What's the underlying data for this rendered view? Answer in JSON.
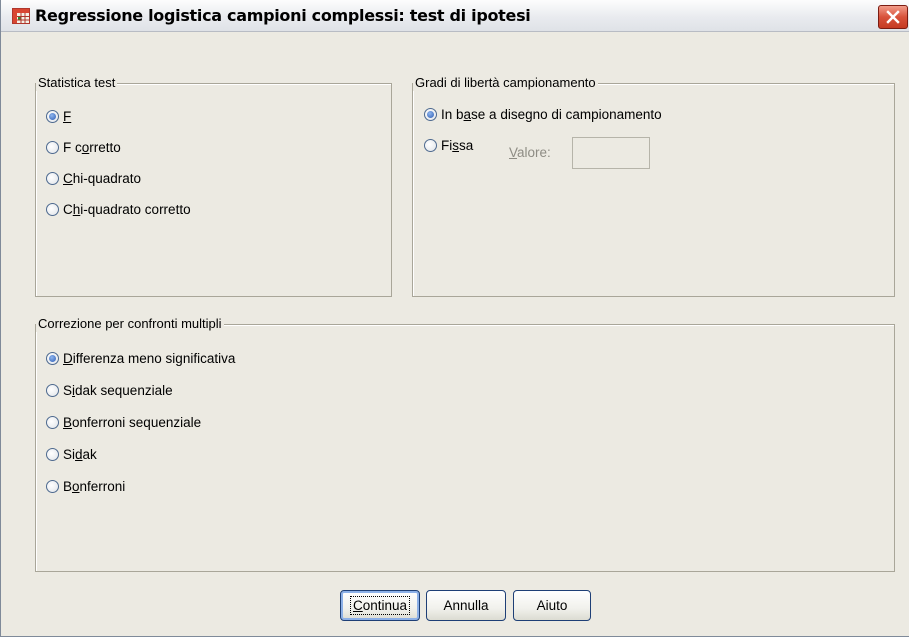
{
  "window": {
    "title": "Regressione logistica campioni complessi: test di ipotesi",
    "close_glyph": "close-icon",
    "accent_color": "#2e5db4"
  },
  "statistica_test": {
    "legend": "Statistica test",
    "options": [
      {
        "pre": "",
        "ul": "F",
        "post": "",
        "checked": true
      },
      {
        "pre": "F c",
        "ul": "o",
        "post": "rretto",
        "checked": false
      },
      {
        "pre": "",
        "ul": "C",
        "post": "hi-quadrato",
        "checked": false
      },
      {
        "pre": "C",
        "ul": "h",
        "post": "i-quadrato corretto",
        "checked": false
      }
    ]
  },
  "gradi_liberta": {
    "legend": "Gradi di libertà campionamento",
    "options": [
      {
        "pre": "In b",
        "ul": "a",
        "post": "se a disegno di campionamento",
        "checked": true
      },
      {
        "pre": "Fi",
        "ul": "s",
        "post": "sa",
        "checked": false
      }
    ],
    "valore": {
      "pre": "",
      "ul": "V",
      "post": "alore:",
      "value": ""
    }
  },
  "correzione": {
    "legend": "Correzione per confronti multipli",
    "options": [
      {
        "pre": "",
        "ul": "D",
        "post": "ifferenza meno significativa",
        "checked": true
      },
      {
        "pre": "S",
        "ul": "i",
        "post": "dak sequenziale",
        "checked": false
      },
      {
        "pre": "",
        "ul": "B",
        "post": "onferroni sequenziale",
        "checked": false
      },
      {
        "pre": "Si",
        "ul": "d",
        "post": "ak",
        "checked": false
      },
      {
        "pre": "B",
        "ul": "o",
        "post": "nferroni",
        "checked": false
      }
    ]
  },
  "buttons": {
    "continua": {
      "pre": "",
      "ul": "C",
      "post": "ontinua"
    },
    "annulla": "Annulla",
    "aiuto": "Aiuto"
  }
}
